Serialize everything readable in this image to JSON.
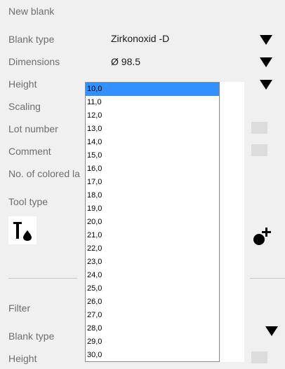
{
  "section_title": "New blank",
  "fields": {
    "blank_type": {
      "label": "Blank type",
      "value": "Zirkonoxid -D",
      "icon": "dropdown-triangle-icon"
    },
    "dimensions": {
      "label": "Dimensions",
      "value": "Ø 98.5",
      "icon": "dropdown-triangle-icon"
    },
    "height": {
      "label": "Height"
    },
    "scaling": {
      "label": "Scaling"
    },
    "lot_number": {
      "label": "Lot number"
    },
    "comment": {
      "label": "Comment"
    },
    "colored_layers": {
      "label": "No. of colored la"
    },
    "tool_type": {
      "label": "Tool type",
      "icon": "tool-drop-icon"
    }
  },
  "add_icon": "add-dot-icon",
  "filter": {
    "title": "Filter",
    "blank_type_label": "Blank type",
    "height_label": "Height"
  },
  "height_dropdown": {
    "selected": "10,0",
    "options": [
      "10,0",
      "11,0",
      "12,0",
      "13,0",
      "14,0",
      "15,0",
      "16,0",
      "17,0",
      "18,0",
      "19,0",
      "20,0",
      "21,0",
      "22,0",
      "23,0",
      "24,0",
      "25,0",
      "26,0",
      "27,0",
      "28,0",
      "29,0",
      "30,0"
    ]
  },
  "colors": {
    "selection": "#3390ff",
    "background": "#f0f0f0"
  }
}
